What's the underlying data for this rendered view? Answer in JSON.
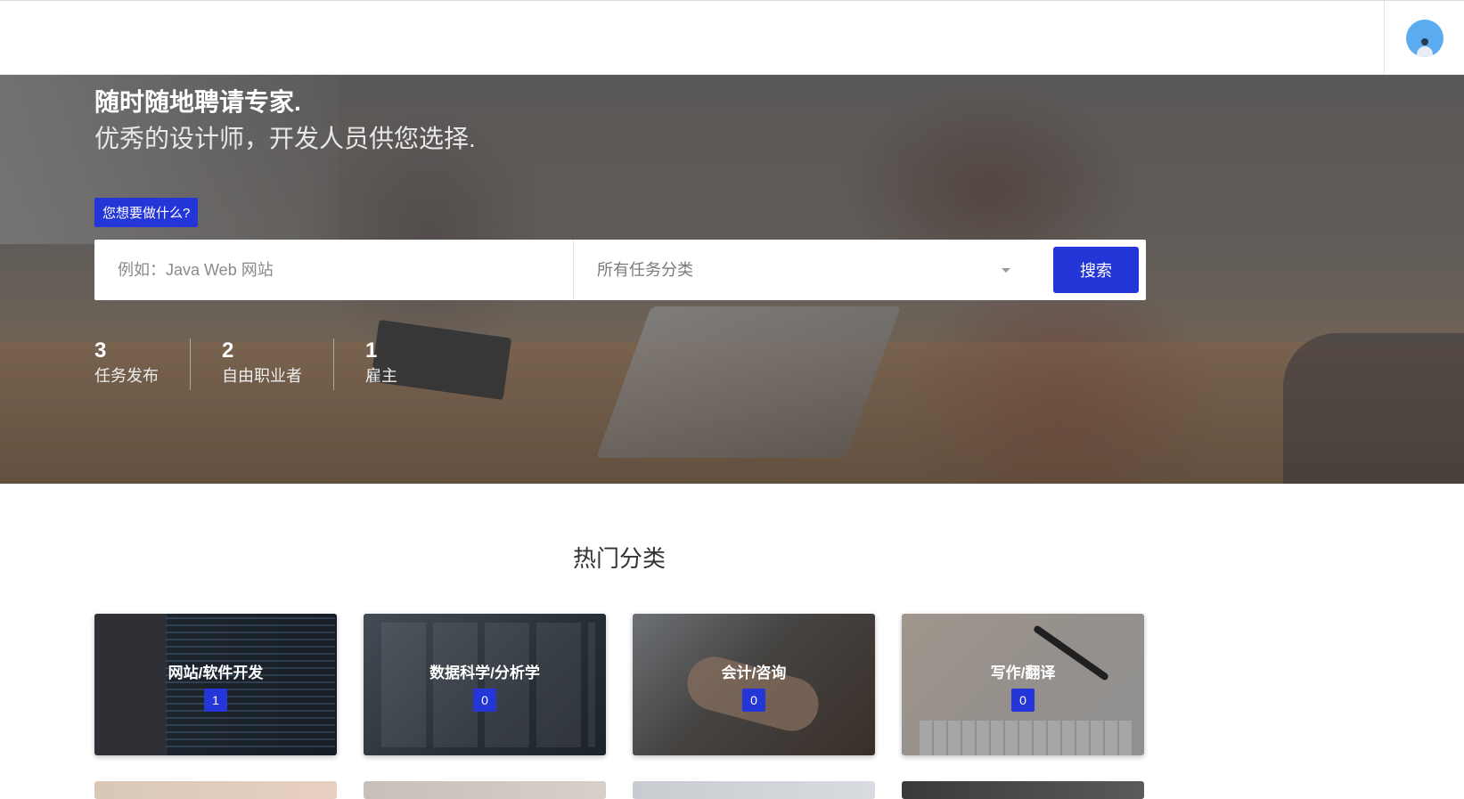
{
  "hero": {
    "headline": "随时随地聘请专家.",
    "subhead": "优秀的设计师，开发人员供您选择.",
    "tag": "您想要做什么?",
    "search": {
      "keyword_placeholder": "例如：Java Web 网站",
      "category_selected": "所有任务分类",
      "button_label": "搜索"
    },
    "stats": [
      {
        "value": "3",
        "label": "任务发布"
      },
      {
        "value": "2",
        "label": "自由职业者"
      },
      {
        "value": "1",
        "label": "雇主"
      }
    ]
  },
  "categories": {
    "title": "热门分类",
    "items": [
      {
        "name": "网站/软件开发",
        "count": "1"
      },
      {
        "name": "数据科学/分析学",
        "count": "0"
      },
      {
        "name": "会计/咨询",
        "count": "0"
      },
      {
        "name": "写作/翻译",
        "count": "0"
      }
    ]
  },
  "colors": {
    "accent": "#2436d8",
    "avatar": "#5aabef"
  },
  "icons": {
    "avatar": "user-avatar-icon",
    "dropdown": "chevron-down-icon"
  }
}
